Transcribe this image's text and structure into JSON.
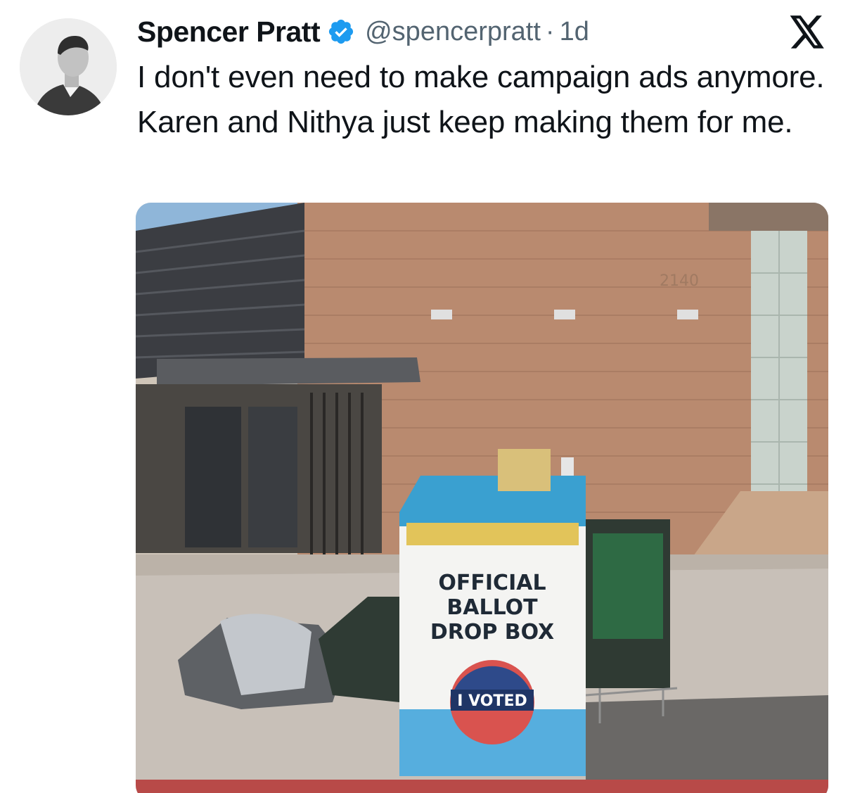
{
  "author": {
    "name": "Spencer Pratt",
    "handle": "@spencerpratt",
    "separator": "·",
    "time": "1d",
    "verified_icon": "verified-badge-icon",
    "verified_color": "#1d9bf0"
  },
  "platform_icon": "x-logo-icon",
  "tweet": {
    "text": "I don't even need to make campaign ads anymore. Karen and Nithya just keep making them for me."
  },
  "media": {
    "description_icon": "photo",
    "box_lines": [
      "OFFICIAL",
      "BALLOT",
      "DROP BOX"
    ],
    "sticker_text": "I VOTED",
    "building_number": "2140"
  },
  "colors": {
    "text_primary": "#0f1419",
    "text_secondary": "#536471",
    "box_blue": "#3aa0d0"
  }
}
